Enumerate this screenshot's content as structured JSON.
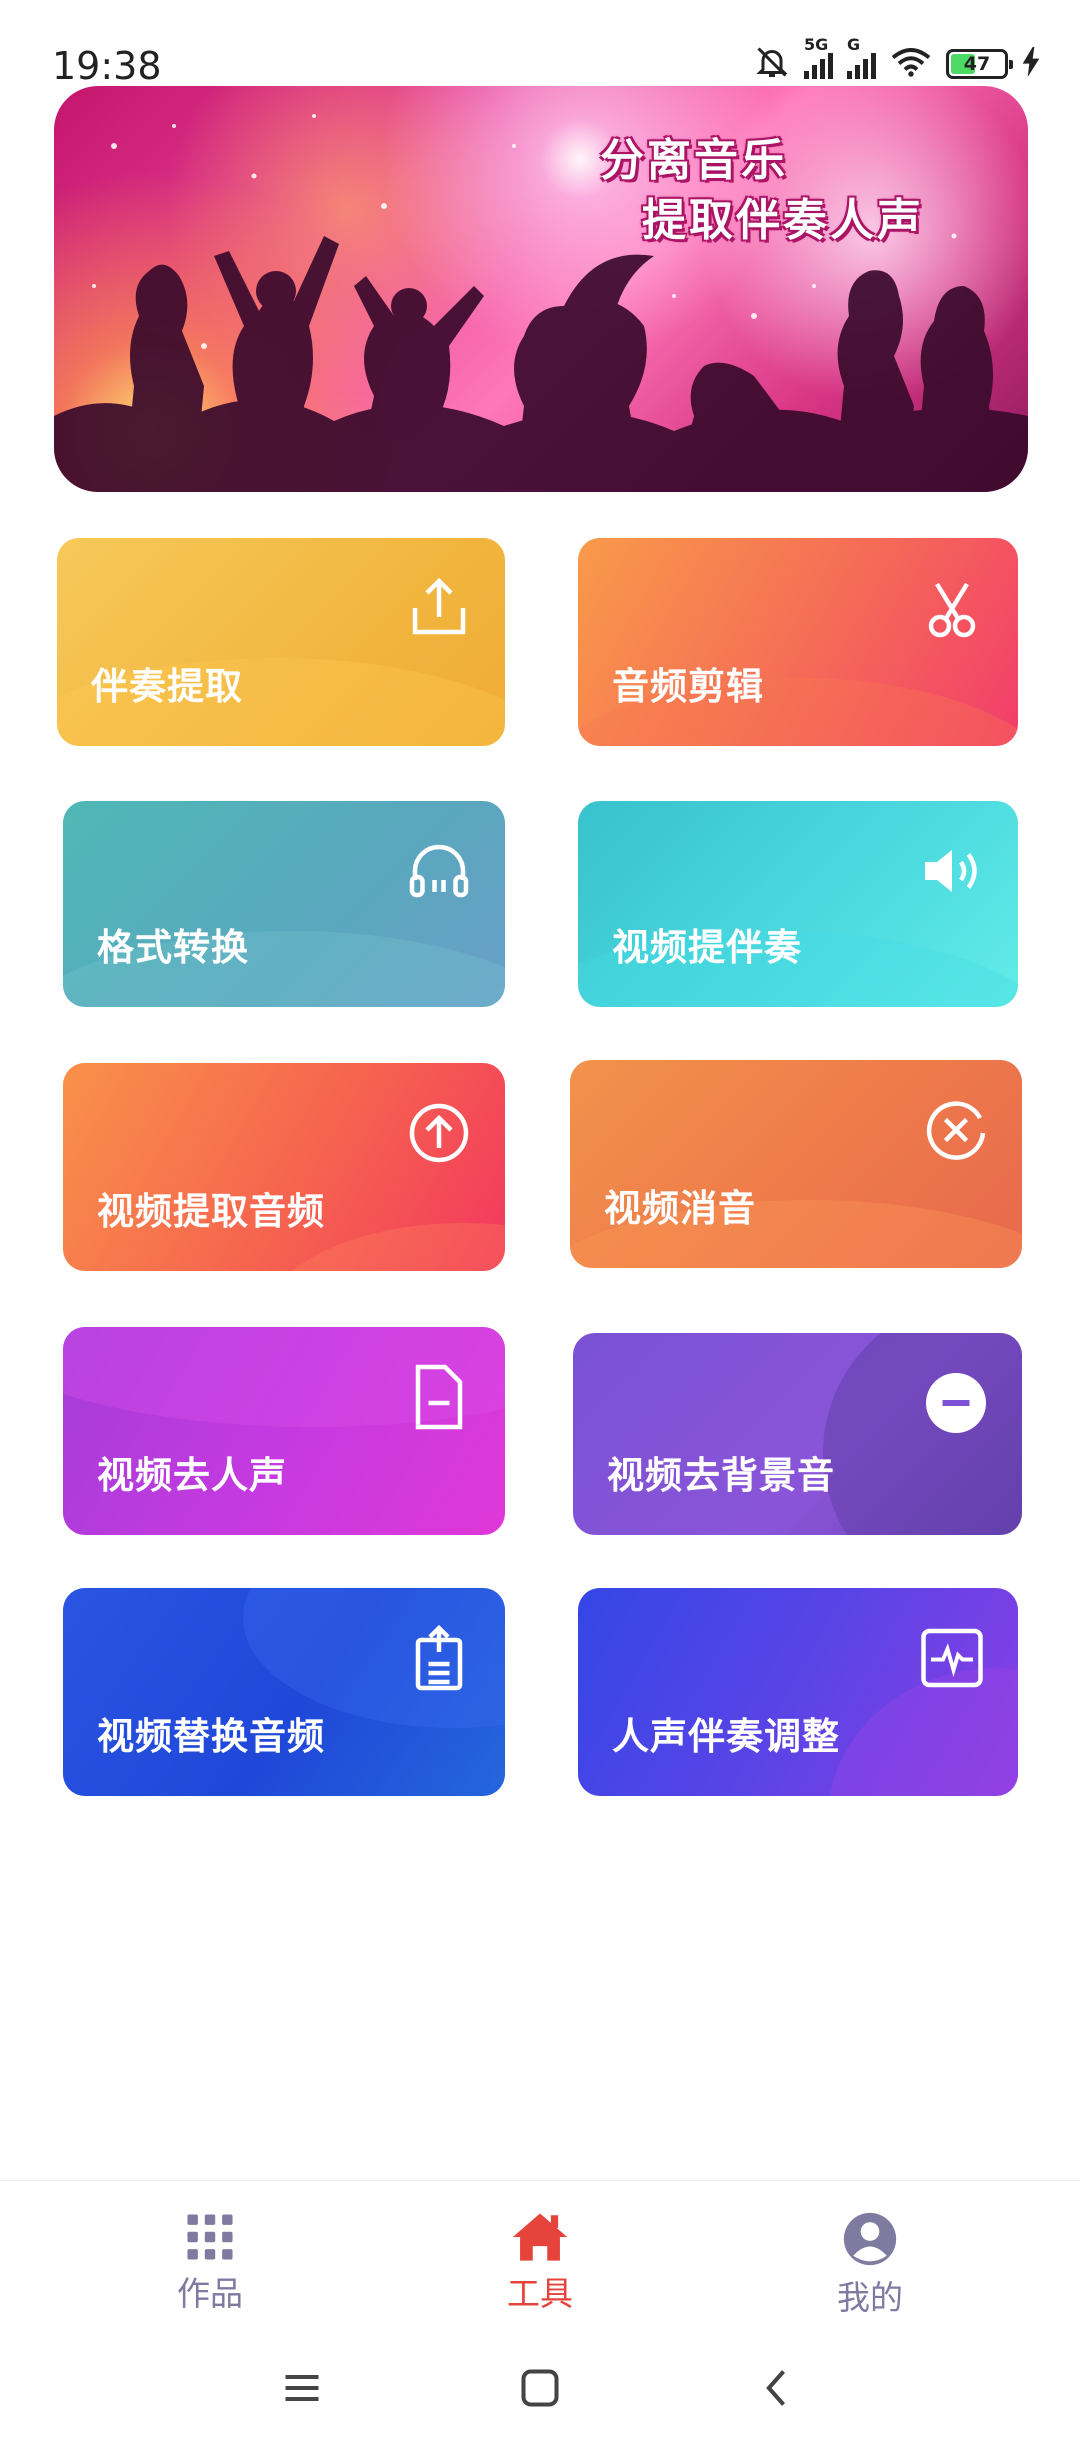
{
  "status_bar": {
    "time": "19:38",
    "battery": "47",
    "net1": "5G",
    "net2": "G"
  },
  "banner": {
    "line1": "分离音乐",
    "line2": "提取伴奏人声"
  },
  "tools": [
    {
      "label": "伴奏提取",
      "icon": "upload-icon"
    },
    {
      "label": "音频剪辑",
      "icon": "scissors-icon"
    },
    {
      "label": "格式转换",
      "icon": "headphones-icon"
    },
    {
      "label": "视频提伴奏",
      "icon": "speaker-icon"
    },
    {
      "label": "视频提取音频",
      "icon": "arrow-up-circle-icon"
    },
    {
      "label": "视频消音",
      "icon": "close-circle-icon"
    },
    {
      "label": "视频去人声",
      "icon": "file-minus-icon"
    },
    {
      "label": "视频去背景音",
      "icon": "minus-circle-icon"
    },
    {
      "label": "视频替换音频",
      "icon": "clipboard-export-icon"
    },
    {
      "label": "人声伴奏调整",
      "icon": "waveform-icon"
    }
  ],
  "bottom_nav": {
    "items": [
      {
        "label": "作品",
        "icon": "grid-icon",
        "active": false
      },
      {
        "label": "工具",
        "icon": "home-icon",
        "active": true
      },
      {
        "label": "我的",
        "icon": "user-icon",
        "active": false
      }
    ],
    "active_color": "#e5433b",
    "inactive_color": "#7e7aa0"
  },
  "colors": {
    "battery_fill": "#4cd964"
  }
}
